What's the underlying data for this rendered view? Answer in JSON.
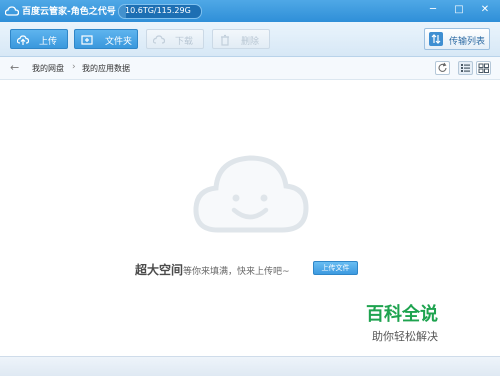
{
  "window": {
    "title": "百度云管家-角色之代号",
    "quota_text": "10.6TG/115.29G",
    "quota_fraction": 0.09,
    "minimize": "─",
    "maximize": "□",
    "close": "✕"
  },
  "toolbar": {
    "upload": "上传",
    "new_folder": "文件夹",
    "download": "下载",
    "delete": "删除",
    "transfer_list": "传输列表"
  },
  "breadcrumb": {
    "items": [
      "我的网盘",
      "我的应用数据"
    ],
    "separator": "›"
  },
  "empty_state": {
    "big": "超大空间",
    "small": "等你来填满，快来上传吧~",
    "button": "上传文件"
  },
  "watermark": {
    "big": "百科全说",
    "small": "助你轻松解决"
  },
  "colors": {
    "titlebar": "#3a98dd",
    "accent": "#2f86c8",
    "watermark_green": "#1ea34f"
  }
}
